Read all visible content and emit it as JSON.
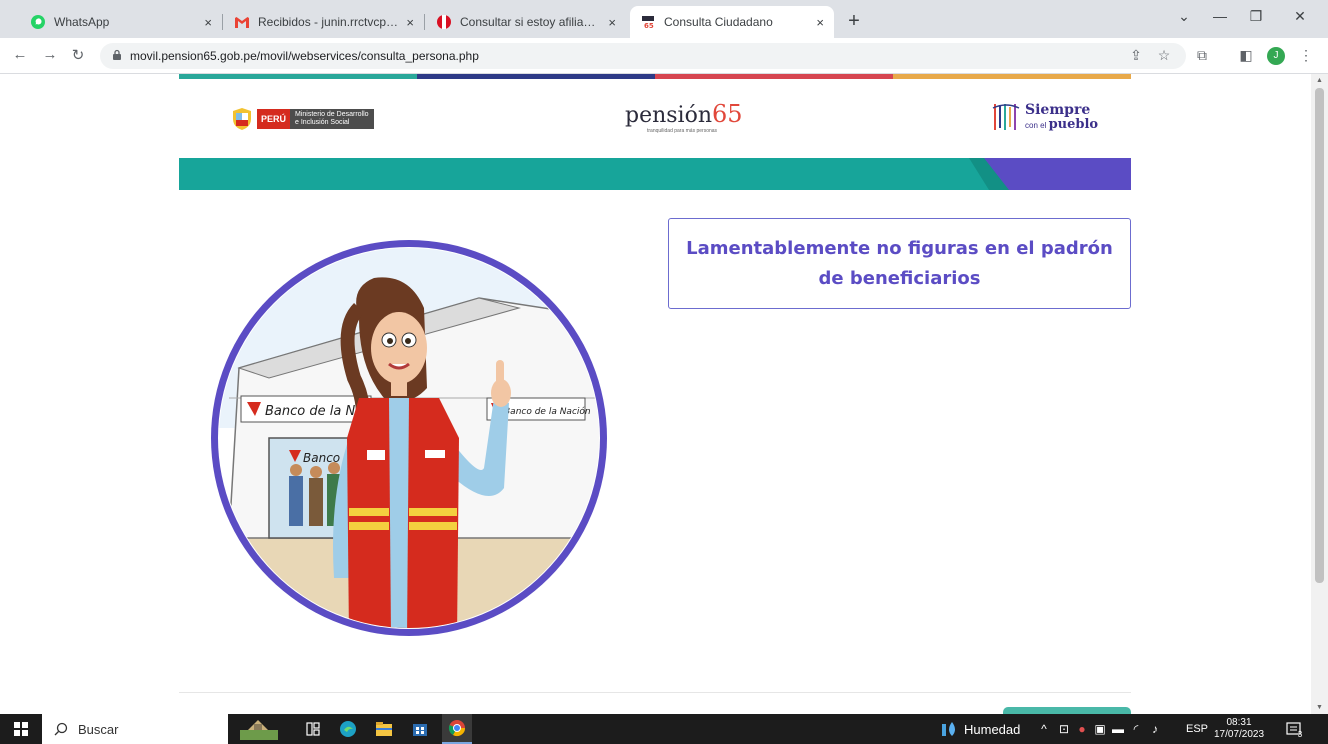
{
  "browser": {
    "tabs": [
      {
        "title": "WhatsApp",
        "icon": "whatsapp-icon"
      },
      {
        "title": "Recibidos - junin.rrctvcperu@g",
        "icon": "gmail-icon"
      },
      {
        "title": "Consultar si estoy afiliado al Pro",
        "icon": "peru-flag-icon"
      },
      {
        "title": "Consulta Ciudadano",
        "icon": "pension65-icon",
        "active": true
      }
    ],
    "close_glyph": "×",
    "new_tab_glyph": "+",
    "url": "movil.pension65.gob.pe/movil/webservices/consulta_persona.php",
    "profile_initial": "J"
  },
  "header": {
    "peru_label": "PERÚ",
    "ministry_line1": "Ministerio de Desarrollo",
    "ministry_line2": "e Inclusión Social",
    "pension_word": "pensión",
    "pension_number": "65",
    "pension_tagline": "tranquilidad para más personas",
    "siempre_big": "Siempre",
    "siempre_con": "con el",
    "siempre_pueblo": "pueblo"
  },
  "main": {
    "message": "Lamentablemente no figuras en el padrón de beneficiarios",
    "illustration": {
      "bank_sign_left": "Banco de la Nación",
      "bank_sign_right": "Banco de la Nación",
      "bank_door_sign": "Banco"
    }
  },
  "colors": {
    "accent_purple": "#5b4cc4",
    "teal": "#17a59a",
    "stripe_teal": "#2aa89a",
    "stripe_navy": "#2e3a87",
    "stripe_red": "#d64550",
    "stripe_orange": "#e8a94a"
  },
  "taskbar": {
    "search_placeholder": "Buscar",
    "weather": "Humedad",
    "language": "ESP",
    "time": "08:31",
    "date": "17/07/2023",
    "notifications": "3"
  }
}
